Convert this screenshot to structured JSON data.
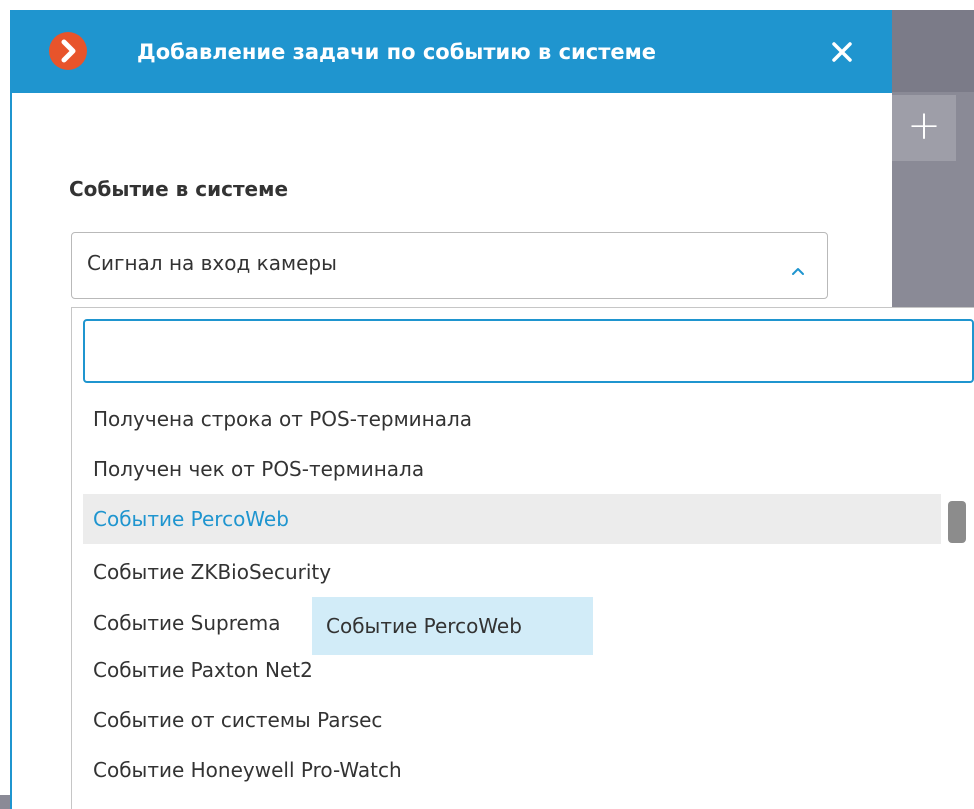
{
  "dialog": {
    "title": "Добавление задачи по событию в системе",
    "close_icon": "close-icon",
    "logo_icon": "app-logo-icon"
  },
  "background": {
    "add_label": "+"
  },
  "form": {
    "event_label": "Событие в системе",
    "event_selected": "Сигнал на вход камеры",
    "search_placeholder": "",
    "search_value": ""
  },
  "dropdown": {
    "options": [
      {
        "label": "Получена строка от POS-терминала",
        "selected": false
      },
      {
        "label": "Получен чек от POS-терминала",
        "selected": false
      },
      {
        "label": "Событие PercoWeb",
        "selected": true
      },
      {
        "label": "Событие ZKBioSecurity",
        "selected": false
      },
      {
        "label": "Событие Suprema",
        "selected": false
      },
      {
        "label": "Событие Paxton Net2",
        "selected": false
      },
      {
        "label": "Событие от системы Parsec",
        "selected": false
      },
      {
        "label": "Событие Honeywell Pro-Watch",
        "selected": false
      }
    ]
  },
  "tooltip": {
    "text": "Событие PercoWeb"
  },
  "colors": {
    "header": "#1f95cf",
    "accent": "#1f95cf",
    "logo": "#e8542b",
    "selected_bg": "#ececec",
    "tooltip_bg": "#d2ecf8"
  }
}
